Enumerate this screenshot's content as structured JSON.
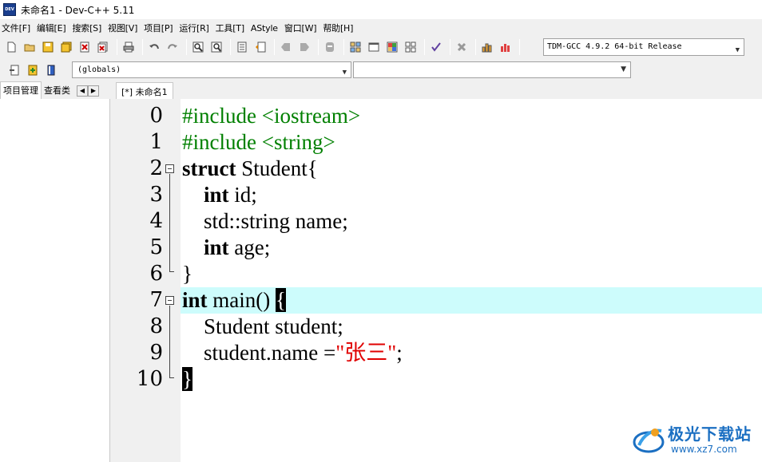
{
  "window": {
    "title": "未命名1 - Dev-C++ 5.11",
    "icon_text": "DEV"
  },
  "menu": [
    "文件[F]",
    "编辑[E]",
    "搜索[S]",
    "视图[V]",
    "项目[P]",
    "运行[R]",
    "工具[T]",
    "AStyle",
    "窗口[W]",
    "帮助[H]"
  ],
  "toolbar": {
    "compiler": "TDM-GCC 4.9.2 64-bit Release",
    "scope": "(globals)",
    "members": ""
  },
  "left_panel": {
    "tabs": [
      "项目管理",
      "查看类"
    ]
  },
  "editor": {
    "tab_label": "[*] 未命名1",
    "current_line": 7,
    "lines": [
      {
        "no": "0",
        "text": "#include <iostream>"
      },
      {
        "no": "1",
        "text": "#include <string>"
      },
      {
        "no": "2",
        "text": "struct Student{"
      },
      {
        "no": "3",
        "text": "    int id;"
      },
      {
        "no": "4",
        "text": "    std::string name;"
      },
      {
        "no": "5",
        "text": "    int age;"
      },
      {
        "no": "6",
        "text": "}"
      },
      {
        "no": "7",
        "text": "int main() {"
      },
      {
        "no": "8",
        "text": "    Student student;"
      },
      {
        "no": "9",
        "text": "    student.name =\"张三\";"
      },
      {
        "no": "10",
        "text": "}"
      }
    ]
  },
  "watermark": {
    "name": "极光下载站",
    "url": "www.xz7.com"
  },
  "colors": {
    "current_line": "#cdfcfc",
    "preprocessor": "#008000",
    "string": "#e00000",
    "watermark": "#1b6fc2"
  }
}
